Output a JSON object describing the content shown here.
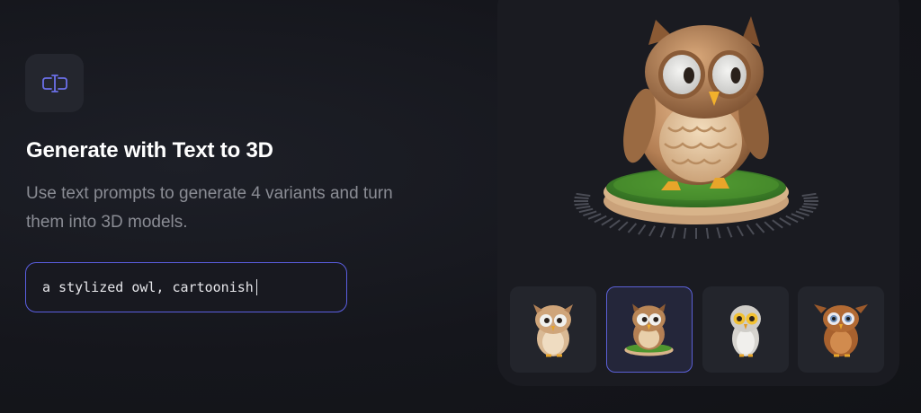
{
  "feature": {
    "icon": "text-cursor-icon",
    "title": "Generate with Text to 3D",
    "description": "Use text prompts to generate 4 variants and turn them into 3D models."
  },
  "prompt": {
    "value": "a stylized owl, cartoonish"
  },
  "preview": {
    "model_icon": "owl-3d-model",
    "thumbnails": [
      {
        "icon": "owl-variant-1-icon",
        "selected": false
      },
      {
        "icon": "owl-variant-2-icon",
        "selected": true
      },
      {
        "icon": "owl-variant-3-icon",
        "selected": false
      },
      {
        "icon": "owl-variant-4-icon",
        "selected": false
      }
    ]
  },
  "colors": {
    "accent": "#5a5ee0",
    "background": "#15161c",
    "panel": "#1a1b21",
    "title": "#ffffff",
    "description": "#8a8c94"
  }
}
